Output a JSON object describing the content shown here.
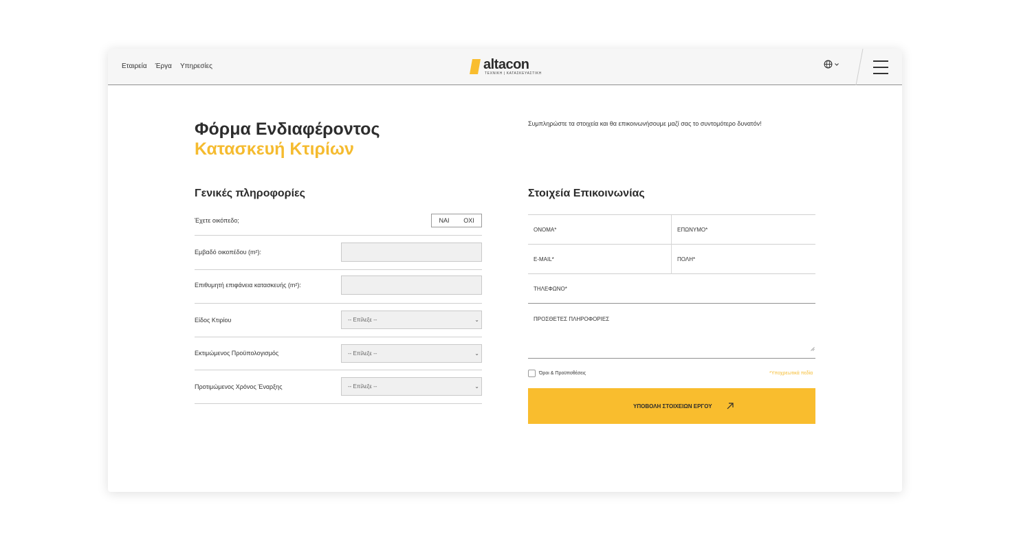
{
  "header": {
    "nav": [
      "Εταιρεία",
      "Έργα",
      "Υπηρεσίες"
    ],
    "logo_text": "altacon",
    "logo_sub": "ΤΕΧΝΙΚΗ  |  ΚΑΤΑΣΚΕΥΑΣΤΙΚΗ",
    "language_icon": "globe-icon",
    "menu_icon": "hamburger-icon"
  },
  "hero": {
    "title": "Φόρμα Ενδιαφέροντος",
    "subtitle": "Κατασκευή Κτιρίων",
    "intro": "Συμπληρώστε τα στοιχεία και θα επικοινωνήσουμε μαζί σας το συντομότερο δυνατόν!"
  },
  "general": {
    "title": "Γενικές πληροφορίες",
    "plot_question": "Έχετε οικόπεδο;",
    "yes_label": "ΝΑΙ",
    "no_label": "ΟΧΙ",
    "plot_area_label": "Εμβαδό οικοπέδου (m²):",
    "build_area_label": "Επιθυμητή επιφάνεια κατασκευής (m²):",
    "building_type_label": "Είδος Κτιρίου",
    "budget_label": "Εκτιμώμενος Προϋπολογισμός",
    "start_label": "Προτιμώμενος Χρόνος Έναρξης",
    "select_placeholder": "-- Επίλεξε --"
  },
  "contact": {
    "title": "Στοιχεία Επικοινωνίας",
    "first_name": "ΟΝΟΜΑ*",
    "last_name": "ΕΠΩΝΥΜΟ*",
    "email": "E-MAIL*",
    "city": "ΠΟΛΗ*",
    "phone": "ΤΗΛΕΦΩΝΟ*",
    "extra_info": "ΠΡΟΣΘΕΤΕΣ ΠΛΗΡΟΦΟΡΙΕΣ",
    "terms_label": "Όροι & Προϋποθέσεις",
    "required_note": "*Υποχρεωτικά πεδία",
    "submit_label": "ΥΠΟΒΟΛΗ ΣΤΟΙΧΕΙΩΝ ΕΡΓΟΥ",
    "submit_icon": "arrow-up-right-icon"
  },
  "colors": {
    "accent": "#f9bd2e",
    "title_accent": "#f5bb2f",
    "text": "#2b2b2b"
  }
}
